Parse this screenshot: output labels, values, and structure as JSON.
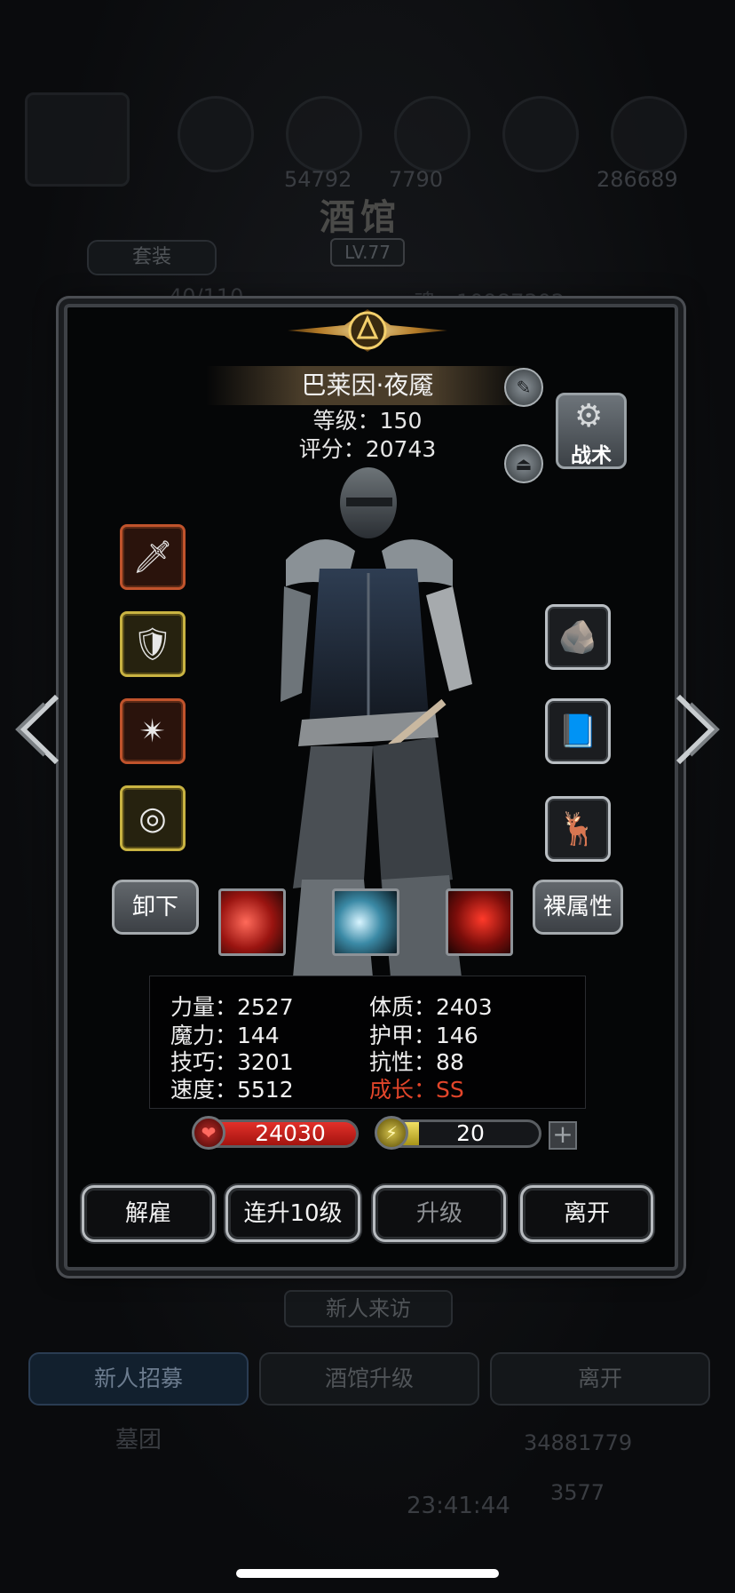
{
  "background": {
    "title": "酒馆",
    "level": "LV.77",
    "outfit_tab": "套装",
    "count_partial": "40/110",
    "souls_partial": "魂：10987302",
    "resource_partial_1": "54792",
    "resource_partial_2": "7790",
    "resource_partial_3": "286689",
    "visitor_label": "新人来访",
    "tab_recruit": "新人招募",
    "tab_upgrade": "酒馆升级",
    "tab_leave": "离开",
    "corps_label": "墓团",
    "gold_value": "34881779",
    "gem_value": "3577",
    "clock": "23:41:44"
  },
  "hero": {
    "name": "巴莱因·夜魇",
    "level_label": "等级：150",
    "score_label": "评分：20743"
  },
  "buttons": {
    "tactics": "战术",
    "unequip": "卸下",
    "naked_attrs": "裸属性",
    "dismiss": "解雇",
    "level_up_10": "连升10级",
    "level_up": "升级",
    "leave": "离开"
  },
  "stats": {
    "strength": "力量：2527",
    "magic": "魔力：144",
    "skill": "技巧：3201",
    "speed": "速度：5512",
    "constitution": "体质：2403",
    "armor": "护甲：146",
    "resistance": "抗性：88",
    "growth": "成长：SS"
  },
  "bars": {
    "hp": "24030",
    "energy": "20",
    "energy_fill": 0.25
  },
  "equipment_left": [
    "spear-icon",
    "armor-icon",
    "crystal-icon",
    "ring-icon"
  ],
  "equipment_right": [
    "ore-icon",
    "book-icon",
    "antler-icon"
  ],
  "colors": {
    "growth": "#e2452a",
    "hp": "#e3302a",
    "energy": "#f1e063"
  }
}
